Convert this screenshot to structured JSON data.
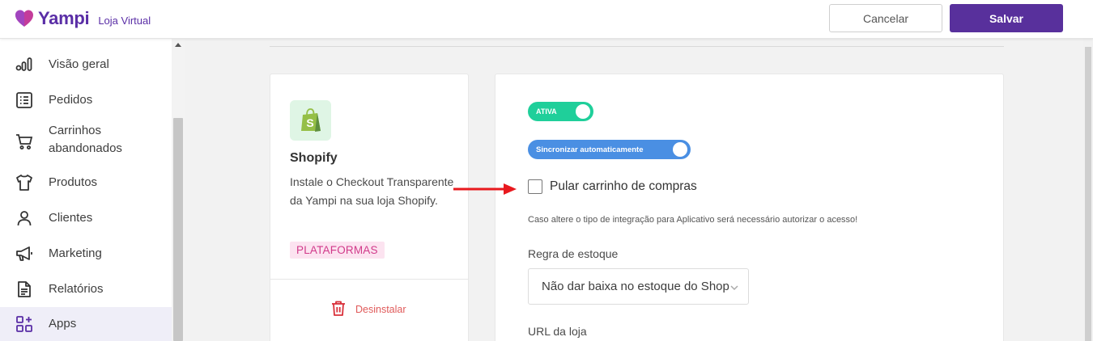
{
  "header": {
    "brand": "Yampi",
    "subtitle": "Loja Virtual",
    "cancel_label": "Cancelar",
    "save_label": "Salvar",
    "brand_color": "#5a2ea6",
    "save_color": "#58309c"
  },
  "sidebar": {
    "items": [
      {
        "label": "Visão geral",
        "icon": "bar-chart-icon"
      },
      {
        "label": "Pedidos",
        "icon": "list-icon"
      },
      {
        "label": "Carrinhos abandonados",
        "icon": "cart-icon"
      },
      {
        "label": "Produtos",
        "icon": "shirt-icon"
      },
      {
        "label": "Clientes",
        "icon": "user-icon"
      },
      {
        "label": "Marketing",
        "icon": "megaphone-icon"
      },
      {
        "label": "Relatórios",
        "icon": "report-icon"
      },
      {
        "label": "Apps",
        "icon": "apps-icon",
        "active": true
      }
    ]
  },
  "app_card": {
    "logo": "shopify-bag-icon",
    "title": "Shopify",
    "description": "Instale o Checkout Transparente da Yampi na sua loja Shopify.",
    "tag": "PLATAFORMAS",
    "uninstall_label": "Desinstalar"
  },
  "settings": {
    "active_toggle_label": "ATIVA",
    "active_toggle_on": true,
    "sync_toggle_label": "Sincronizar automaticamente",
    "sync_toggle_on": true,
    "skip_cart_label": "Pular carrinho de compras",
    "skip_cart_checked": false,
    "hint": "Caso altere o tipo de integração para Aplicativo será necessário autorizar o acesso!",
    "stock_rule_label": "Regra de estoque",
    "stock_rule_value": "Não dar baixa no estoque do Shopify",
    "store_url_label": "URL da loja",
    "active_color": "#1fcf9a",
    "sync_color": "#4a8fe3"
  }
}
